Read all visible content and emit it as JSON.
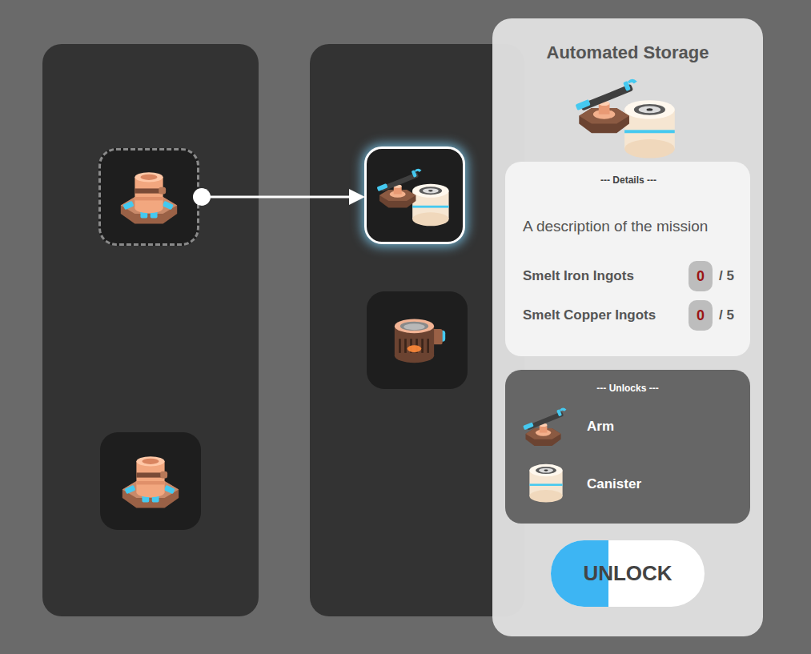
{
  "tree": {
    "columns": [
      {
        "nodes": [
          {
            "selected": false,
            "kind": "source"
          },
          {
            "selected": false,
            "kind": "plain"
          }
        ]
      },
      {
        "nodes": [
          {
            "selected": true,
            "kind": "plain"
          },
          {
            "selected": false,
            "kind": "plain"
          }
        ]
      }
    ]
  },
  "panel": {
    "title": "Automated Storage",
    "details": {
      "heading": "--- Details ---",
      "description": "A description of the mission",
      "objectives": [
        {
          "label": "Smelt Iron Ingots",
          "count": "0",
          "total": "/ 5",
          "complete": false
        },
        {
          "label": "Smelt Copper Ingots",
          "count": "0",
          "total": "/ 5",
          "complete": false
        }
      ]
    },
    "unlocks": {
      "heading": "--- Unlocks ---",
      "items": [
        {
          "label": "Arm"
        },
        {
          "label": "Canister"
        }
      ]
    },
    "button": {
      "label": "UNLOCK",
      "level": 0.375
    }
  }
}
